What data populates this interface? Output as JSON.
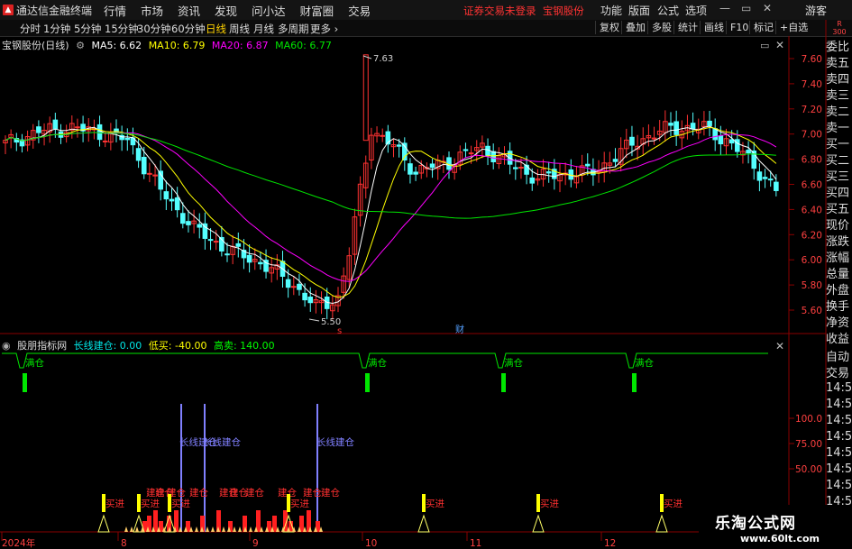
{
  "menubar": {
    "app_title": "通达信金融终端",
    "items": [
      "行情",
      "市场",
      "资讯",
      "发现",
      "问小达",
      "财富圈",
      "交易"
    ],
    "alert": "证券交易未登录",
    "stock": "宝钢股份",
    "right_items": [
      "功能",
      "版面",
      "公式",
      "选项"
    ],
    "guest": "游客"
  },
  "toolbar": {
    "periods": [
      "分时",
      "1分钟",
      "5分钟",
      "15分钟",
      "30分钟",
      "60分钟",
      "日线",
      "周线",
      "月线",
      "多周期",
      "更多"
    ],
    "active_period": "日线",
    "right_buttons": [
      "复权",
      "叠加",
      "多股",
      "统计",
      "画线",
      "F10",
      "标记",
      "+自选"
    ]
  },
  "chart_legend": {
    "title": "宝钢股份(日线)",
    "ma5": "MA5: 6.62",
    "ma10": "MA10: 6.79",
    "ma20": "MA20: 6.87",
    "ma60": "MA60: 6.77"
  },
  "indicator_legend": {
    "title": "股朋指标网",
    "long_build": "长线建仓: 0.00",
    "low_buy": "低买: -40.00",
    "high_sell": "高卖: 140.00"
  },
  "price_axis": [
    "7.60",
    "7.40",
    "7.20",
    "7.00",
    "6.80",
    "6.60",
    "6.40",
    "6.20",
    "6.00",
    "5.80",
    "5.60"
  ],
  "indicator_axis": [
    "100.0",
    "75.00",
    "50.00"
  ],
  "price_annotations": {
    "high": "7.63",
    "low": "5.50"
  },
  "markers": {
    "s": "s",
    "cai": "财"
  },
  "date_axis": [
    "2024年",
    "8",
    "9",
    "10",
    "11",
    "12"
  ],
  "signal_labels": {
    "full": "满仓",
    "long_build": "长线建仓",
    "build": "建仓",
    "enter": "买进"
  },
  "right_panel": {
    "badge_top": "R",
    "badge_num": "300",
    "items": [
      "委比",
      "卖五",
      "卖四",
      "卖三",
      "卖二",
      "卖一",
      "买一",
      "买二",
      "买三",
      "买四",
      "买五",
      "现价",
      "涨跌",
      "涨幅",
      "总量",
      "外盘",
      "换手",
      "净资",
      "收益",
      "自动",
      "交易"
    ],
    "times": [
      "14:56",
      "14:56",
      "14:56",
      "14:56",
      "14:56",
      "14:56",
      "14:56",
      "14:56",
      "14:56",
      "14:56"
    ]
  },
  "watermark": {
    "line1": "乐淘公式网",
    "line2": "www.60lt.com"
  },
  "colors": {
    "up": "#ff3232",
    "down": "#54ffff",
    "ma5": "#ffffff",
    "ma10": "#ffff00",
    "ma20": "#ff00ff",
    "ma60": "#00e600",
    "grid": "#7a0000"
  }
}
